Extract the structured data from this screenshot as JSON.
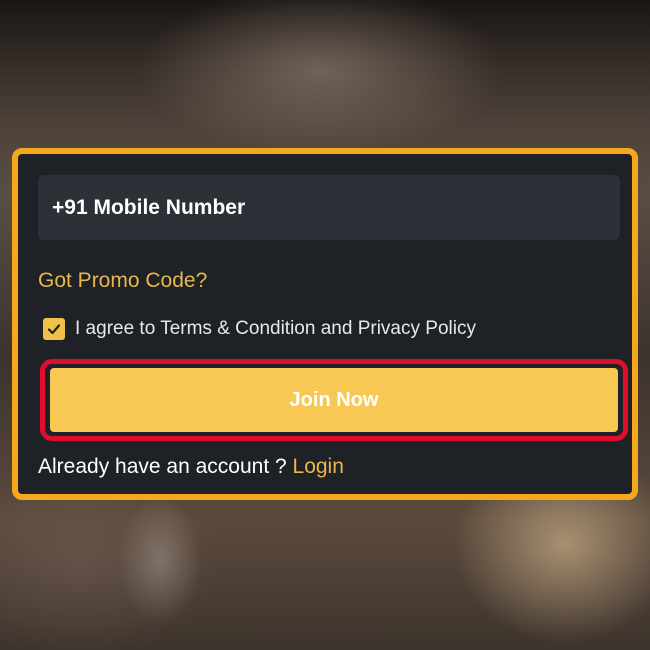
{
  "form": {
    "mobile_placeholder": "+91 Mobile Number",
    "promo_link": "Got Promo Code?",
    "agree_checked": true,
    "agree_text": "I agree to Terms & Condition and Privacy Policy",
    "join_label": "Join Now",
    "account_prompt": "Already have an account ?",
    "login_link": "Login"
  },
  "icons": {
    "check": "check-icon"
  },
  "colors": {
    "card_border": "#f5a81c",
    "card_bg": "#1e2125",
    "accent": "#e8b84b",
    "button": "#f7c853",
    "highlight": "#e00d2c"
  }
}
